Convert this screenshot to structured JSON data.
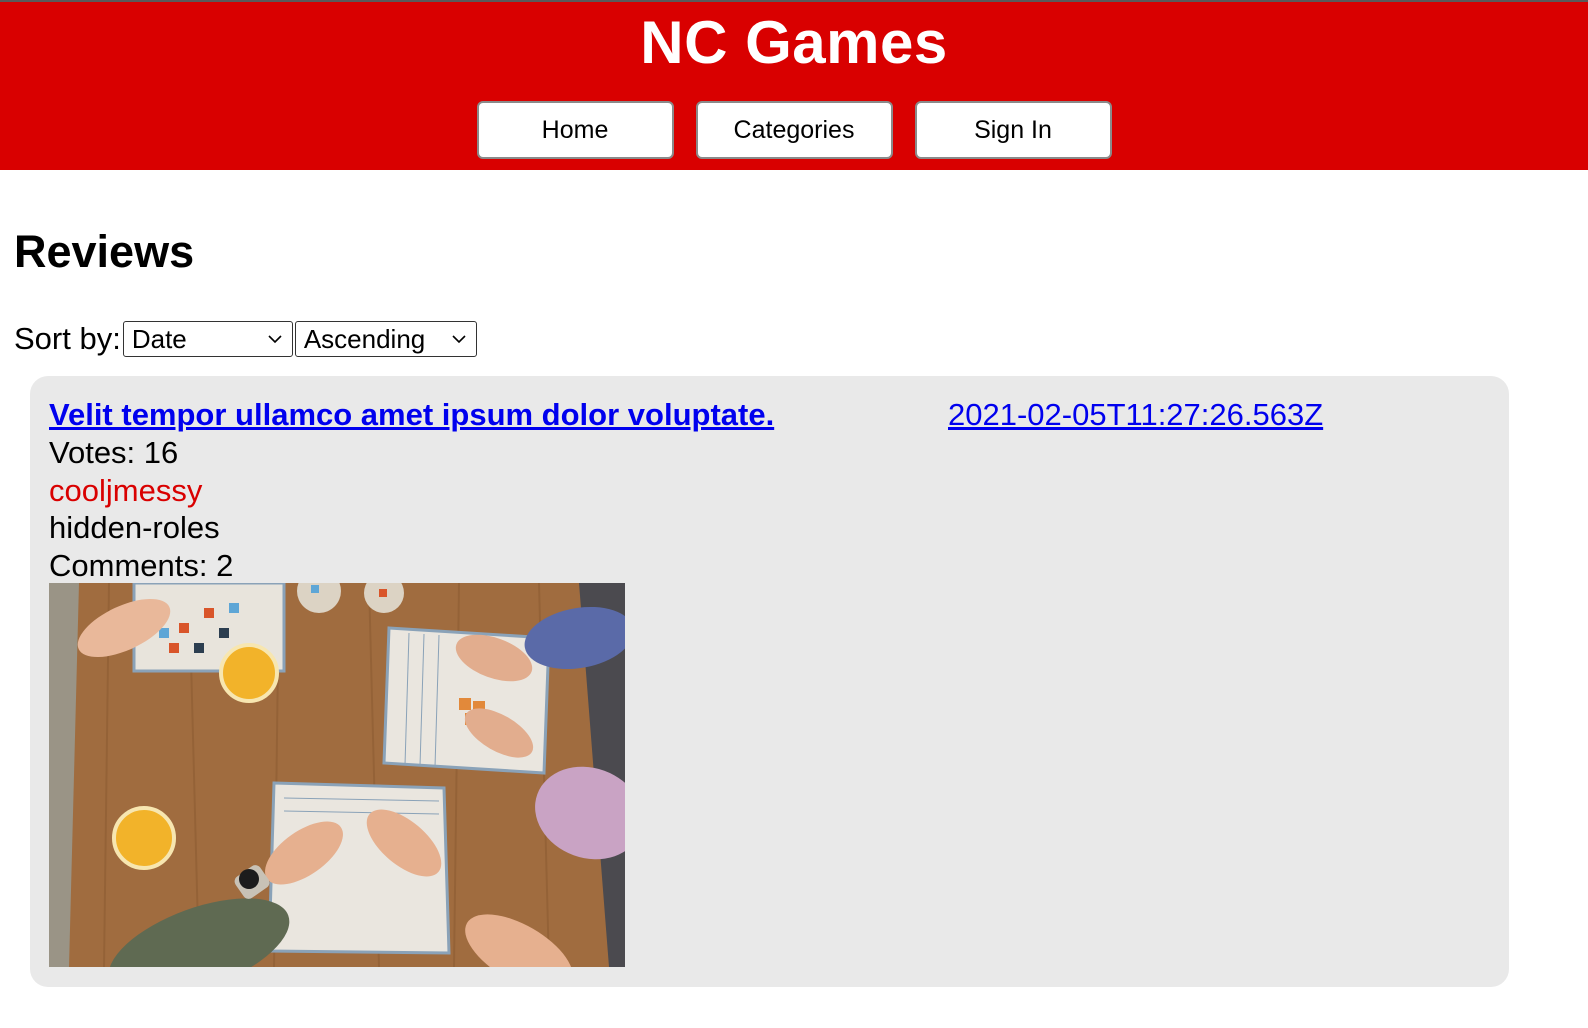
{
  "header": {
    "title": "NC Games",
    "nav": {
      "home_label": "Home",
      "categories_label": "Categories",
      "signin_label": "Sign In"
    }
  },
  "main": {
    "heading": "Reviews",
    "sort": {
      "label": "Sort by:",
      "field_value": "Date",
      "order_value": "Ascending"
    },
    "reviews": [
      {
        "title": "Velit tempor ullamco amet ipsum dolor voluptate.",
        "created_at": "2021-02-05T11:27:26.563Z",
        "votes_text": "Votes: 16",
        "author": "cooljmessy",
        "category": "hidden-roles",
        "comments_text": "Comments: 2",
        "image_icon": "board-game-photo"
      }
    ]
  },
  "colors": {
    "brand_red": "#d90000",
    "card_bg": "#e9e9e9",
    "link_blue": "#0000ee"
  }
}
